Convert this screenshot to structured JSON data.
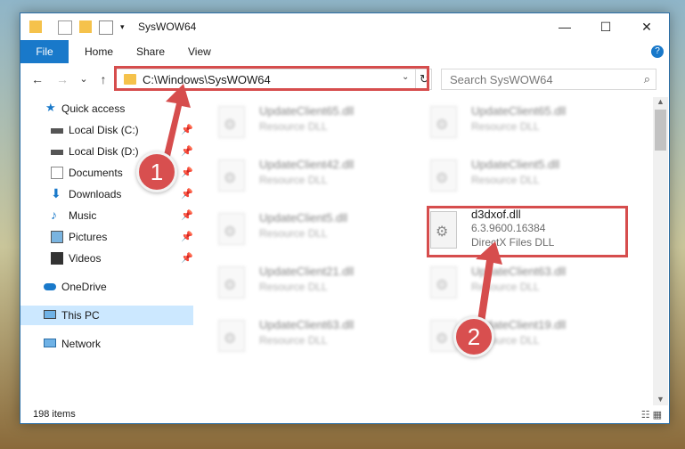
{
  "window": {
    "title": "SysWOW64",
    "minimize_glyph": "—",
    "maximize_glyph": "☐",
    "close_glyph": "✕"
  },
  "ribbon": {
    "file": "File",
    "tabs": [
      "Home",
      "Share",
      "View"
    ],
    "help": "?"
  },
  "nav": {
    "back": "←",
    "forward": "→",
    "recent": "⌄",
    "up": "↑",
    "address": "C:\\Windows\\SysWOW64",
    "search_placeholder": "Search SysWOW64"
  },
  "sidebar": {
    "items": [
      {
        "label": "Quick access",
        "icon": "star-icon"
      },
      {
        "label": "Local Disk (C:)",
        "icon": "drive-icon",
        "pinned": true
      },
      {
        "label": "Local Disk (D:)",
        "icon": "drive-icon",
        "pinned": true
      },
      {
        "label": "Documents",
        "icon": "documents-icon",
        "pinned": true
      },
      {
        "label": "Downloads",
        "icon": "download-icon",
        "pinned": true
      },
      {
        "label": "Music",
        "icon": "music-icon",
        "pinned": true
      },
      {
        "label": "Pictures",
        "icon": "pictures-icon",
        "pinned": true
      },
      {
        "label": "Videos",
        "icon": "videos-icon",
        "pinned": true
      },
      {
        "label": "OneDrive",
        "icon": "cloud-icon"
      },
      {
        "label": "This PC",
        "icon": "computer-icon",
        "selected": true
      },
      {
        "label": "Network",
        "icon": "network-icon"
      }
    ]
  },
  "files": {
    "left_column": [
      {
        "name": "UpdateClient65.dll",
        "type": "Resource DLL"
      },
      {
        "name": "UpdateClient42.dll",
        "type": "Resource DLL"
      },
      {
        "name": "UpdateClient5.dll",
        "type": "Resource DLL"
      },
      {
        "name": "UpdateClient21.dll",
        "type": "Resource DLL"
      },
      {
        "name": "UpdateClient63.dll",
        "type": "Resource DLL"
      }
    ],
    "right_column": [
      {
        "name": "UpdateClient65.dll",
        "type": "Resource DLL"
      },
      {
        "name": "UpdateClient5.dll",
        "type": "Resource DLL"
      },
      {
        "name": "d3dxof.dll",
        "version": "6.3.9600.16384",
        "type": "DirectX Files DLL",
        "highlighted": true
      },
      {
        "name": "UpdateClient63.dll",
        "type": "Resource DLL"
      },
      {
        "name": "UpdateClient19.dll",
        "type": "Resource DLL"
      }
    ]
  },
  "status": {
    "count": "198 items"
  },
  "annotations": {
    "badge1": "1",
    "badge2": "2",
    "color": "#d64d4d"
  }
}
